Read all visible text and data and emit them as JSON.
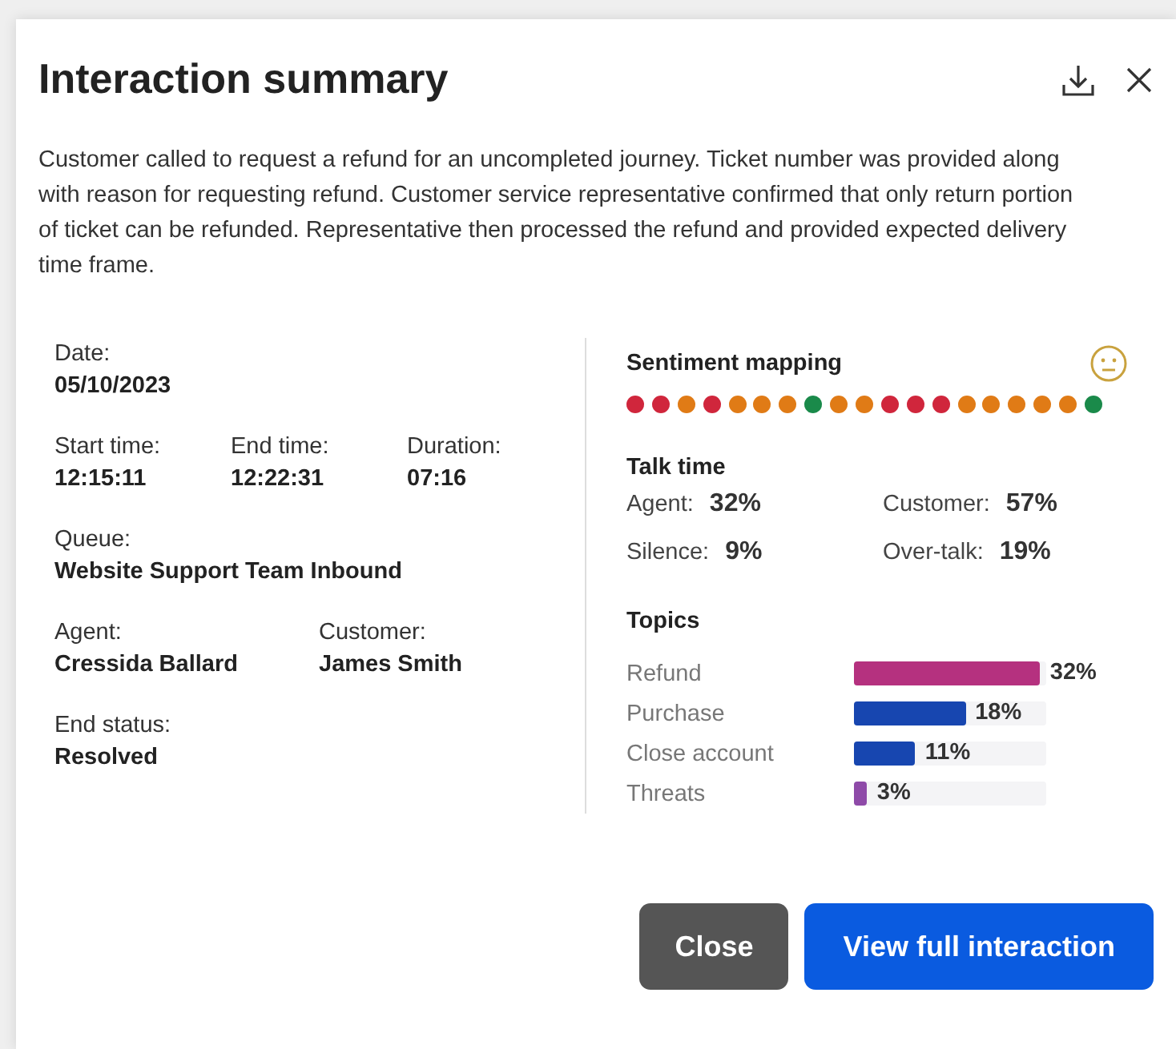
{
  "title": "Interaction summary",
  "summary": "Customer called to request a refund for an uncompleted journey. Ticket number was provided along with reason for requesting refund. Customer service representative confirmed that only return portion of ticket can be refunded. Representative then processed the refund and provided expected delivery time frame.",
  "details": [
    [
      {
        "label": "Date:",
        "value": "05/10/2023"
      }
    ],
    [
      {
        "label": "Start time:",
        "value": "12:15:11"
      },
      {
        "label": "End time:",
        "value": "12:22:31"
      },
      {
        "label": "Duration:",
        "value": "07:16"
      }
    ],
    [
      {
        "label": "Queue:",
        "value": "Website Support Team Inbound"
      }
    ],
    [
      {
        "label": "Agent:",
        "value": "Cressida Ballard"
      },
      {
        "label": "Customer:",
        "value": "James Smith"
      }
    ],
    [
      {
        "label": "End status:",
        "value": "Resolved"
      }
    ]
  ],
  "sentiment": {
    "title": "Sentiment mapping",
    "dots": [
      {
        "color": "#d0263c"
      },
      {
        "color": "#d0263c"
      },
      {
        "color": "#e07b16"
      },
      {
        "color": "#d0263c"
      },
      {
        "color": "#e07b16"
      },
      {
        "color": "#e07b16"
      },
      {
        "color": "#e07b16"
      },
      {
        "color": "#1a8a4a"
      },
      {
        "color": "#e07b16"
      },
      {
        "color": "#e07b16"
      },
      {
        "color": "#d0263c"
      },
      {
        "color": "#d0263c"
      },
      {
        "color": "#d0263c"
      },
      {
        "color": "#e07b16"
      },
      {
        "color": "#e07b16"
      },
      {
        "color": "#e07b16"
      },
      {
        "color": "#e07b16"
      },
      {
        "color": "#e07b16"
      },
      {
        "color": "#1a8a4a"
      }
    ]
  },
  "talk_time": {
    "title": "Talk time",
    "items": [
      {
        "label": "Agent:",
        "value": "32%"
      },
      {
        "label": "Customer:",
        "value": "57%"
      },
      {
        "label": "Silence:",
        "value": "9%"
      },
      {
        "label": "Over-talk:",
        "value": "19%"
      }
    ]
  },
  "topics": {
    "title": "Topics",
    "items": [
      {
        "label": "Refund",
        "value": "32%",
        "level": 0.97,
        "color": "#b5317f"
      },
      {
        "label": "Purchase",
        "value": "18%",
        "level": 0.58,
        "color": "#1746b0"
      },
      {
        "label": "Close account",
        "value": "11%",
        "level": 0.32,
        "color": "#1746b0"
      },
      {
        "label": "Threats",
        "value": "3%",
        "level": 0.07,
        "color": "#8e4aa8"
      }
    ]
  },
  "buttons": [
    {
      "label": "Close",
      "kind": "secondary"
    },
    {
      "label": "View full interaction",
      "kind": "primary"
    }
  ]
}
